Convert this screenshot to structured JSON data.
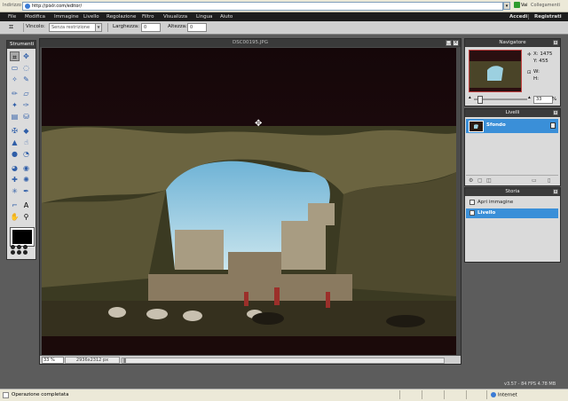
{
  "browser": {
    "address_label": "Indirizzo",
    "url": "http://pixlr.com/editor/",
    "go_label": "Vai",
    "links_label": "Collegamenti"
  },
  "menu": {
    "items": [
      "File",
      "Modifica",
      "Immagine",
      "Livello",
      "Regolazione",
      "Filtro",
      "Visualizza",
      "Lingua",
      "Aiuto"
    ],
    "login": "Accedi",
    "register": "Registrati"
  },
  "options": {
    "constraint_label": "Vincolo:",
    "constraint_value": "Senza restrizione",
    "width_label": "Larghezza:",
    "width_value": "0",
    "height_label": "Altezza:",
    "height_value": "0"
  },
  "tools": {
    "title": "Strumenti"
  },
  "document": {
    "title": "DSC00195.JPG",
    "zoom": "33",
    "zoom_unit": "%",
    "dimensions": "2936x2312 px"
  },
  "navigator": {
    "title": "Navigatore",
    "x_label": "X:",
    "x_value": "1475",
    "y_label": "Y:",
    "y_value": "455",
    "w_label": "W:",
    "h_label": "H:",
    "zoom": "33",
    "zoom_unit": "%"
  },
  "layers": {
    "title": "Livelli",
    "items": [
      {
        "name": "Sfondo",
        "selected": true
      }
    ]
  },
  "history": {
    "title": "Storia",
    "items": [
      {
        "label": "Apri immagine",
        "selected": false
      },
      {
        "label": "Livello",
        "selected": true
      }
    ]
  },
  "stats": "v3.57 - 84 FPS 4.78 MB",
  "status": {
    "message": "Operazione completata",
    "zone": "Internet"
  },
  "colors": {
    "menu_bg": "#1d1d1d",
    "workspace_bg": "#5c5c5c",
    "selection_blue": "#3a8fd8",
    "panel_header": "#3b3b3b"
  }
}
